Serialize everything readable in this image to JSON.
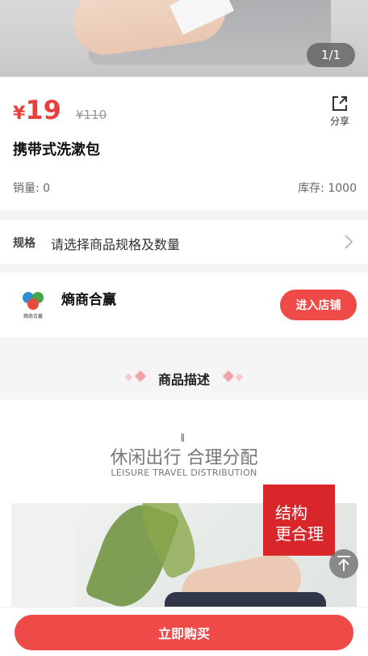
{
  "gallery": {
    "counter": "1/1"
  },
  "product": {
    "currency": "¥",
    "price": "19",
    "original_price": "¥110",
    "title": "携带式洗漱包",
    "sales_label": "销量:",
    "sales_value": "0",
    "stock_label": "库存:",
    "stock_value": "1000",
    "share_label": "分享"
  },
  "spec": {
    "label": "规格",
    "value": "请选择商品规格及数量"
  },
  "shop": {
    "name": "熵商合赢",
    "logo_text": "熵商合赢",
    "enter_label": "进入店铺"
  },
  "description": {
    "heading": "商品描述",
    "slogan": "休闲出行 合理分配",
    "slogan_en": "LEISURE TRAVEL DISTRIBUTION",
    "badge_line1": "结构",
    "badge_line2": "更合理"
  },
  "footer": {
    "buy_label": "立即购买"
  },
  "colors": {
    "accent": "#ee4a47",
    "price": "#e8413d",
    "badge": "#d8262a"
  },
  "icons": [
    "share-icon",
    "chevron-right-icon",
    "back-to-top-icon"
  ]
}
